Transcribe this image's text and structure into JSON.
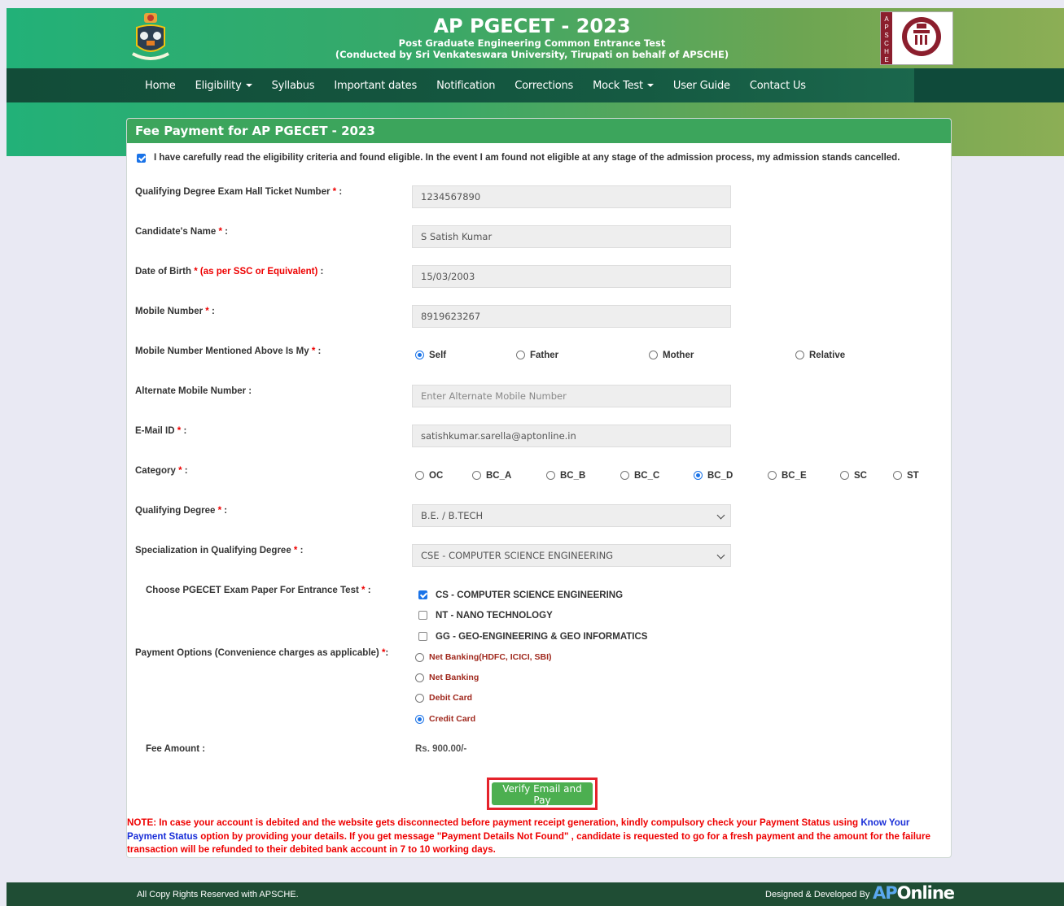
{
  "header": {
    "title": "AP PGECET - 2023",
    "subtitle": "Post Graduate Engineering Common Entrance Test",
    "conducted_by": "(Conducted by Sri Venkateswara University, Tirupati on behalf of APSCHE)",
    "right_logo_letters": "APSCHE"
  },
  "nav": {
    "home": "Home",
    "eligibility": "Eligibility",
    "syllabus": "Syllabus",
    "important_dates": "Important dates",
    "notification": "Notification",
    "corrections": "Corrections",
    "mock_test": "Mock Test",
    "user_guide": "User Guide",
    "contact_us": "Contact Us"
  },
  "panel": {
    "heading": "Fee Payment for AP PGECET - 2023",
    "declaration": "I have carefully read the eligibility criteria and found eligible. In the event I am found not eligible at any stage of the admission process, my admission stands cancelled.",
    "declaration_checked": true
  },
  "form": {
    "hall_ticket": {
      "label": "Qualifying Degree Exam Hall Ticket Number",
      "value": "1234567890"
    },
    "name": {
      "label": "Candidate's Name",
      "value": "S Satish Kumar"
    },
    "dob": {
      "label": "Date of Birth",
      "note": "(as per SSC or Equivalent)",
      "value": "15/03/2003"
    },
    "mobile": {
      "label": "Mobile Number",
      "value": "8919623267"
    },
    "mobile_owner": {
      "label": "Mobile Number Mentioned Above Is My",
      "options": [
        "Self",
        "Father",
        "Mother",
        "Relative"
      ],
      "selected": "Self"
    },
    "alt_mobile": {
      "label": "Alternate Mobile Number :",
      "placeholder": "Enter Alternate Mobile Number"
    },
    "email": {
      "label": "E-Mail ID",
      "value": "satishkumar.sarella@aptonline.in"
    },
    "category": {
      "label": "Category",
      "options": [
        "OC",
        "BC_A",
        "BC_B",
        "BC_C",
        "BC_D",
        "BC_E",
        "SC",
        "ST"
      ],
      "selected": "BC_D"
    },
    "qualifying_degree": {
      "label": "Qualifying Degree",
      "value": "B.E. / B.TECH"
    },
    "specialization": {
      "label": "Specialization in Qualifying Degree",
      "value": "CSE - COMPUTER SCIENCE ENGINEERING"
    },
    "exam_paper": {
      "label": "Choose PGECET Exam Paper For Entrance Test",
      "options": [
        "CS - COMPUTER SCIENCE ENGINEERING",
        "NT - NANO TECHNOLOGY",
        "GG - GEO-ENGINEERING & GEO INFORMATICS"
      ],
      "checked": [
        "CS - COMPUTER SCIENCE ENGINEERING"
      ]
    },
    "payment": {
      "label": "Payment Options (Convenience charges as applicable)",
      "options": [
        "Net Banking(HDFC, ICICI, SBI)",
        "Net Banking",
        "Debit Card",
        "Credit Card"
      ],
      "selected": "Credit Card"
    },
    "fee": {
      "label": "Fee Amount :",
      "value": "Rs. 900.00/-"
    },
    "submit_label": "Verify Email and Pay"
  },
  "note": {
    "part1": "NOTE: In case your account is debited and the website gets disconnected before payment receipt generation, kindly compulsory check your Payment Status using ",
    "link": "Know Your Payment Status",
    "part2": " option by providing your details. If you get message \"Payment Details Not Found\" , candidate is requested to go for a fresh payment and the amount for the failure transaction will be refunded to their debited bank account in 7 to 10 working days."
  },
  "footer": {
    "copyright": "All Copy Rights Reserved with APSCHE.",
    "designed_by": "Designed & Developed By",
    "brand_ap": "AP",
    "brand_online": "Online"
  },
  "colors": {
    "primary_green": "#3ca55c",
    "nav_dark": "#124c38",
    "accent_red": "#e5222b"
  }
}
